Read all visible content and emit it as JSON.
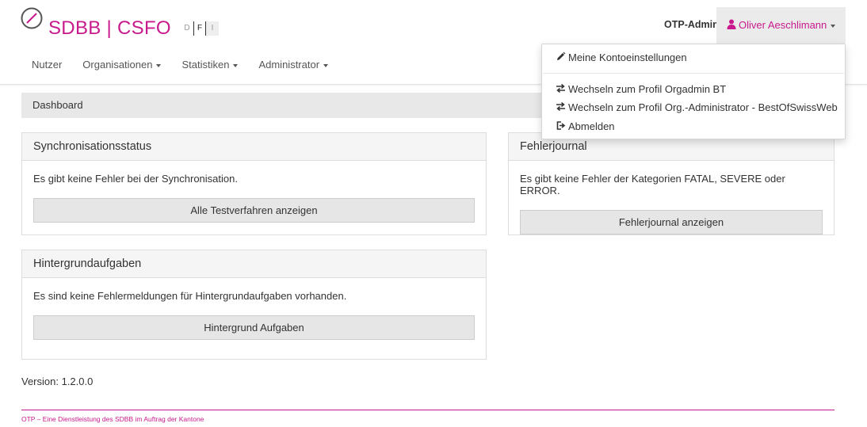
{
  "brand": {
    "logo_text": "SDBB | CSFO",
    "accent_color": "#c81a8c"
  },
  "languages": [
    "D",
    "F",
    "I"
  ],
  "nav": {
    "items": [
      {
        "label": "Nutzer",
        "dropdown": false
      },
      {
        "label": "Organisationen",
        "dropdown": true
      },
      {
        "label": "Statistiken",
        "dropdown": true
      },
      {
        "label": "Administrator",
        "dropdown": true
      }
    ]
  },
  "user": {
    "role": "OTP-Admin",
    "name": "Oliver Aeschlimann",
    "icon": "user-icon"
  },
  "user_menu": {
    "items": [
      {
        "label": "Meine Kontoeinstellungen",
        "icon": "pencil-icon"
      },
      {
        "label": "Wechseln zum Profil Orgadmin BT",
        "icon": "switch-icon"
      },
      {
        "label": "Wechseln zum Profil Org.-Administrator - BestOfSwissWeb",
        "icon": "switch-icon"
      },
      {
        "label": "Abmelden",
        "icon": "logout-icon"
      }
    ]
  },
  "breadcrumb": "Dashboard",
  "panels": {
    "sync": {
      "title": "Synchronisationsstatus",
      "text": "Es gibt keine Fehler bei der Synchronisation.",
      "button": "Alle Testverfahren anzeigen"
    },
    "errors": {
      "title": "Fehlerjournal",
      "text": "Es gibt keine Fehler der Kategorien FATAL, SEVERE oder ERROR.",
      "button": "Fehlerjournal anzeigen"
    },
    "background": {
      "title": "Hintergrundaufgaben",
      "text": "Es sind keine Fehlermeldungen für Hintergrundaufgaben vorhanden.",
      "button": "Hintergrund Aufgaben"
    }
  },
  "version": "Version: 1.2.0.0",
  "footer": "OTP – Eine Dienstleistung des SDBB im Auftrag der Kantone"
}
